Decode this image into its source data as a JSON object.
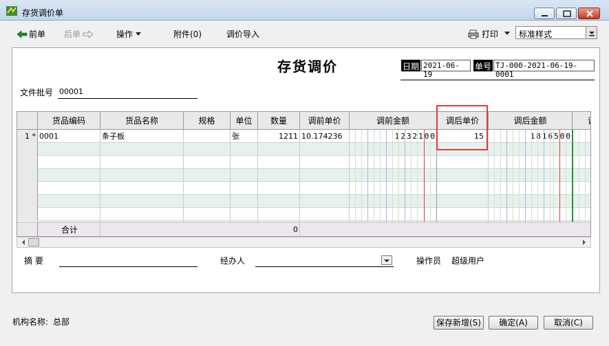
{
  "window": {
    "title": "存货调价单"
  },
  "toolbar": {
    "prev_label": "前单",
    "next_label": "后单",
    "ops_label": "操作",
    "attach_label": "附件(0)",
    "import_label": "调价导入",
    "print_label": "打印",
    "style_value": "标准样式"
  },
  "doc": {
    "title": "存货调价",
    "date_label": "日期",
    "date_value": "2021-06-19",
    "no_label": "单号",
    "no_value": "TJ-000-2021-06-19-0001",
    "batch_label": "文件批号",
    "batch_value": "00001"
  },
  "grid": {
    "headers": [
      "货品编码",
      "货品名称",
      "规格",
      "单位",
      "数量",
      "调前单价",
      "调前金额",
      "调后单价",
      "调后金额",
      "调"
    ],
    "rows": [
      {
        "num": "1",
        "marker": "*",
        "code": "0001",
        "name": "条子板",
        "spec": "",
        "unit": "张",
        "qty": "1211",
        "price_before": "10.174236",
        "amount_before": "1232100",
        "price_after": "15",
        "amount_after": "1816500"
      }
    ],
    "sum_label": "合计",
    "sum_qty": "0"
  },
  "bottom": {
    "summary_label": "摘  要",
    "handler_label": "经办人",
    "operator_label": "操作员",
    "operator_value": "超级用户"
  },
  "footer": {
    "org_label": "机构名称:",
    "org_value": "总部",
    "save_new": "保存新增(S)",
    "confirm": "确定(A)",
    "cancel": "取消(C)"
  }
}
